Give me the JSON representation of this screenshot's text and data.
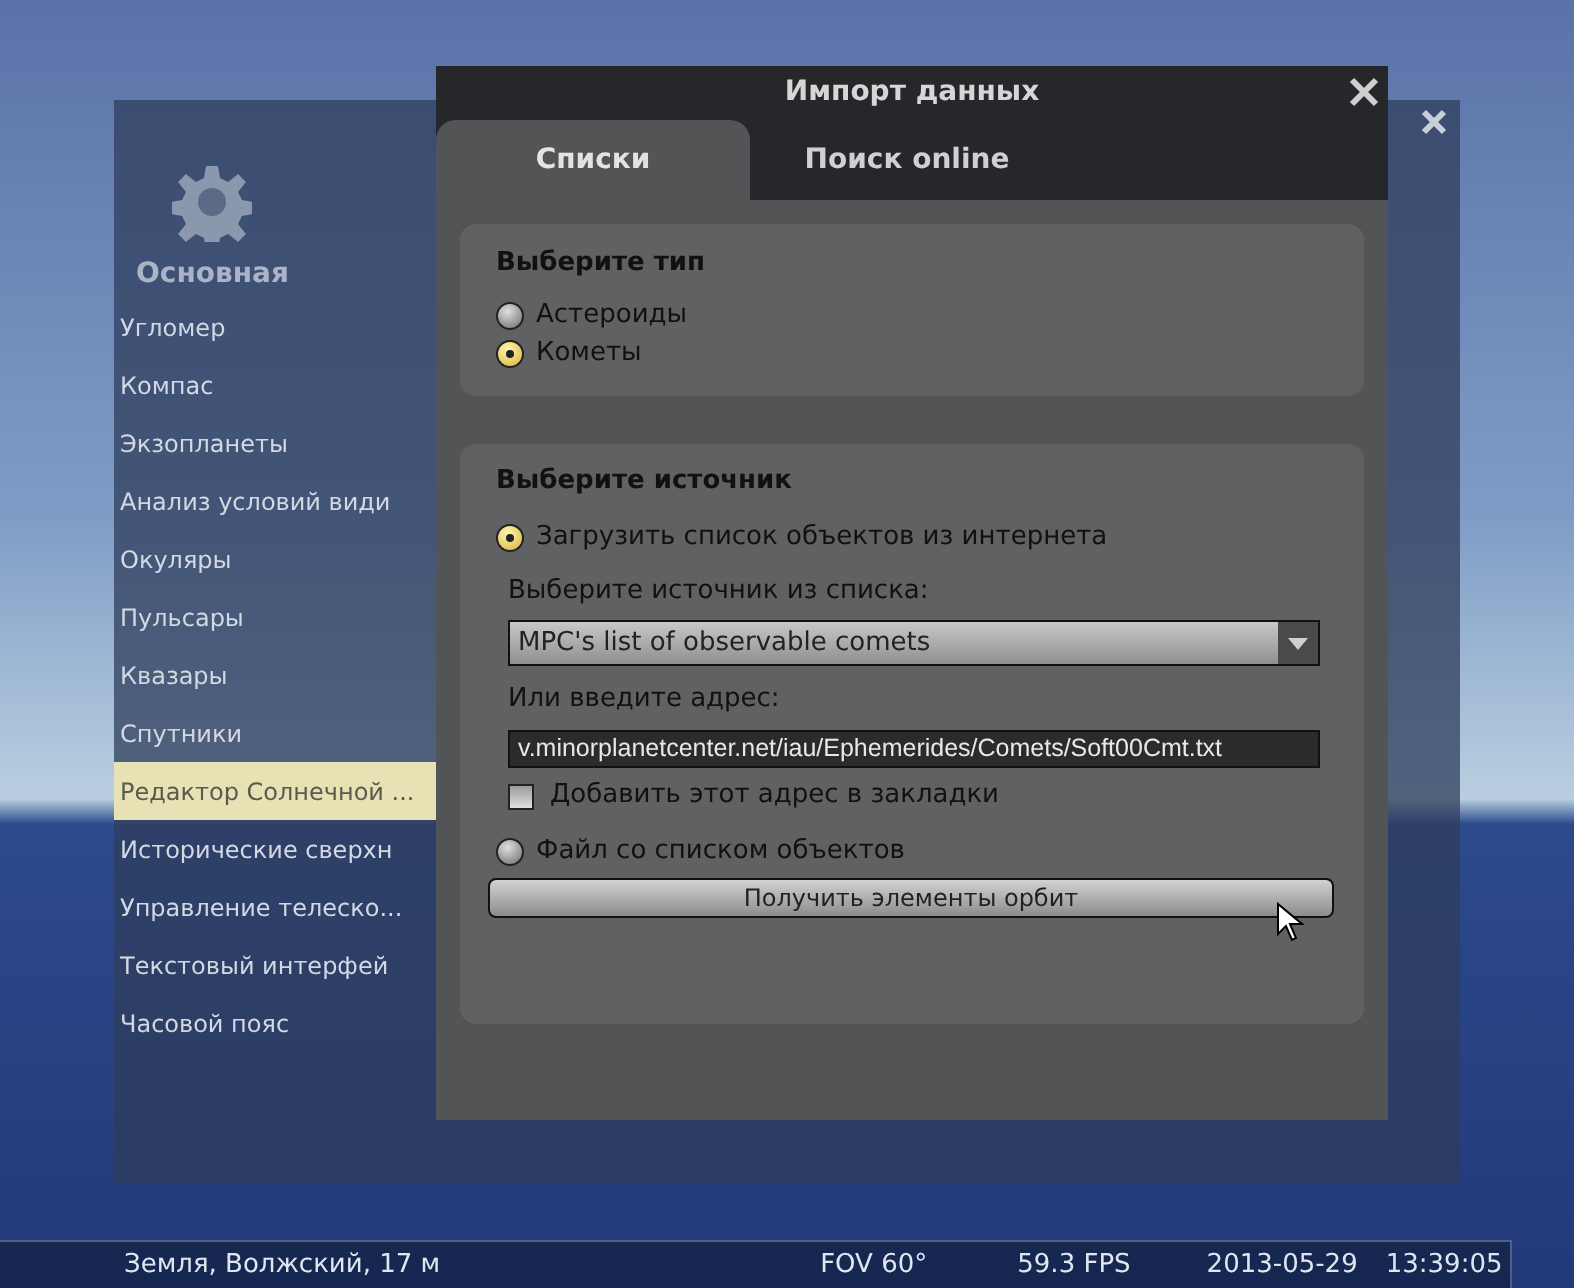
{
  "config_window": {
    "header": "Основная",
    "sidebar": [
      {
        "label": "Угломер",
        "selected": false
      },
      {
        "label": "Компас",
        "selected": false
      },
      {
        "label": "Экзопланеты",
        "selected": false
      },
      {
        "label": "Анализ условий види",
        "selected": false
      },
      {
        "label": "Окуляры",
        "selected": false
      },
      {
        "label": "Пульсары",
        "selected": false
      },
      {
        "label": "Квазары",
        "selected": false
      },
      {
        "label": "Спутники",
        "selected": false
      },
      {
        "label": "Редактор Солнечной ...",
        "selected": true
      },
      {
        "label": "Исторические сверхн",
        "selected": false
      },
      {
        "label": "Управление телеско...",
        "selected": false
      },
      {
        "label": "Текстовый интерфей",
        "selected": false
      },
      {
        "label": "Часовой пояс",
        "selected": false
      }
    ]
  },
  "dialog": {
    "title": "Импорт данных",
    "tabs": [
      {
        "label": "Списки",
        "selected": true
      },
      {
        "label": "Поиск online",
        "selected": false
      }
    ],
    "type_group": {
      "title": "Выберите тип",
      "options": [
        {
          "label": "Астероиды",
          "selected": false
        },
        {
          "label": "Кометы",
          "selected": true
        }
      ]
    },
    "source_group": {
      "title": "Выберите источник",
      "download_option": {
        "label": "Загрузить список объектов из интернета",
        "selected": true
      },
      "list_label": "Выберите источник из списка:",
      "source_select": {
        "value": "MPC's list of observable comets"
      },
      "address_label": "Или введите адрес:",
      "address_field": {
        "value": "v.minorplanetcenter.net/iau/Ephemerides/Comets/Soft00Cmt.txt"
      },
      "bookmark_checkbox": {
        "label": "Добавить этот адрес в закладки",
        "checked": false
      },
      "file_option": {
        "label": "Файл со списком объектов",
        "selected": false
      },
      "fetch_button": "Получить элементы орбит"
    }
  },
  "status_bar": {
    "location": "Земля, Волжский, 17 м",
    "fov": "FOV 60°",
    "fps": "59.3 FPS",
    "date": "2013-05-29",
    "time": "13:39:05"
  }
}
